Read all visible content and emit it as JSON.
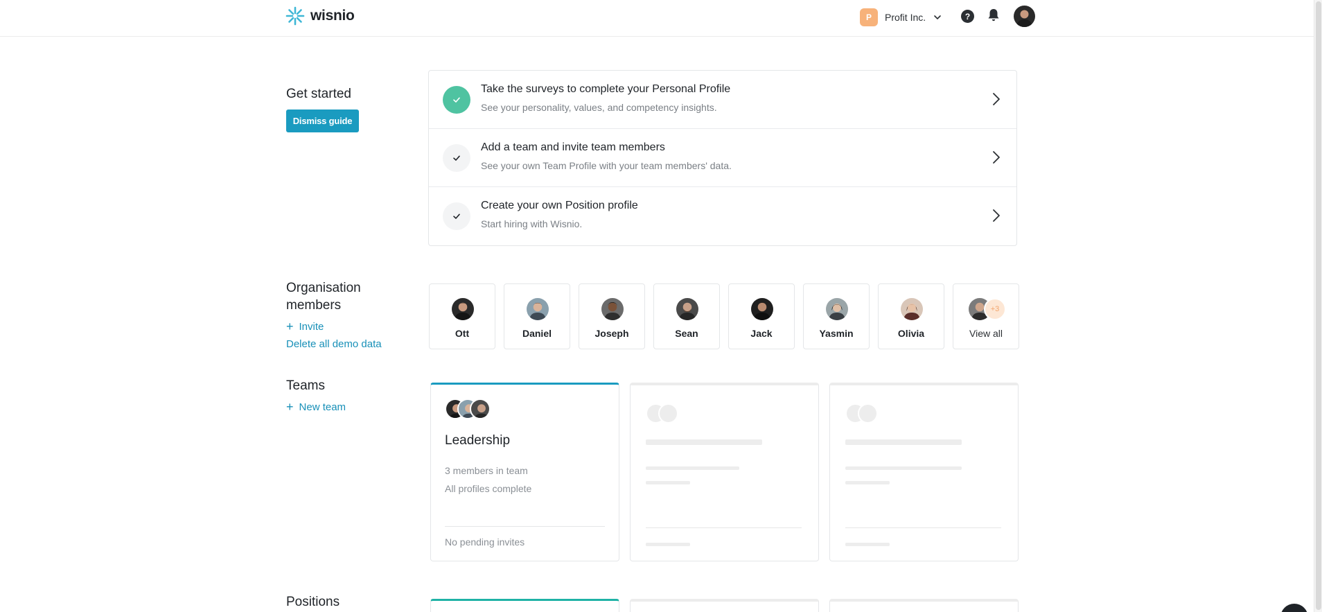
{
  "header": {
    "logo_text": "wisnio",
    "company_initial": "P",
    "company_name": "Profit Inc."
  },
  "colors": {
    "accent": "#1a9bc0",
    "done_green": "#4fc3a1",
    "company_badge": "#f7b27a"
  },
  "get_started": {
    "title": "Get started",
    "dismiss_label": "Dismiss guide",
    "items": [
      {
        "title": "Take the surveys to complete your Personal Profile",
        "desc": "See your personality, values, and competency insights.",
        "done": true
      },
      {
        "title": "Add a team and invite team members",
        "desc": "See your own Team Profile with your team members' data.",
        "done": false
      },
      {
        "title": "Create your own Position profile",
        "desc": "Start hiring with Wisnio.",
        "done": false
      }
    ]
  },
  "organisation": {
    "title_line1": "Organisation",
    "title_line2": "members",
    "invite_label": "Invite",
    "delete_demo_label": "Delete all demo data",
    "members": [
      "Ott",
      "Daniel",
      "Joseph",
      "Sean",
      "Jack",
      "Yasmin",
      "Olivia"
    ],
    "view_all_label": "View all",
    "extra_count": "+3"
  },
  "teams": {
    "title": "Teams",
    "new_team_label": "New team",
    "cards": [
      {
        "name": "Leadership",
        "members_text": "3 members in team",
        "status_text": "All profiles complete",
        "invites_text": "No pending invites"
      }
    ]
  },
  "positions": {
    "title": "Positions"
  }
}
